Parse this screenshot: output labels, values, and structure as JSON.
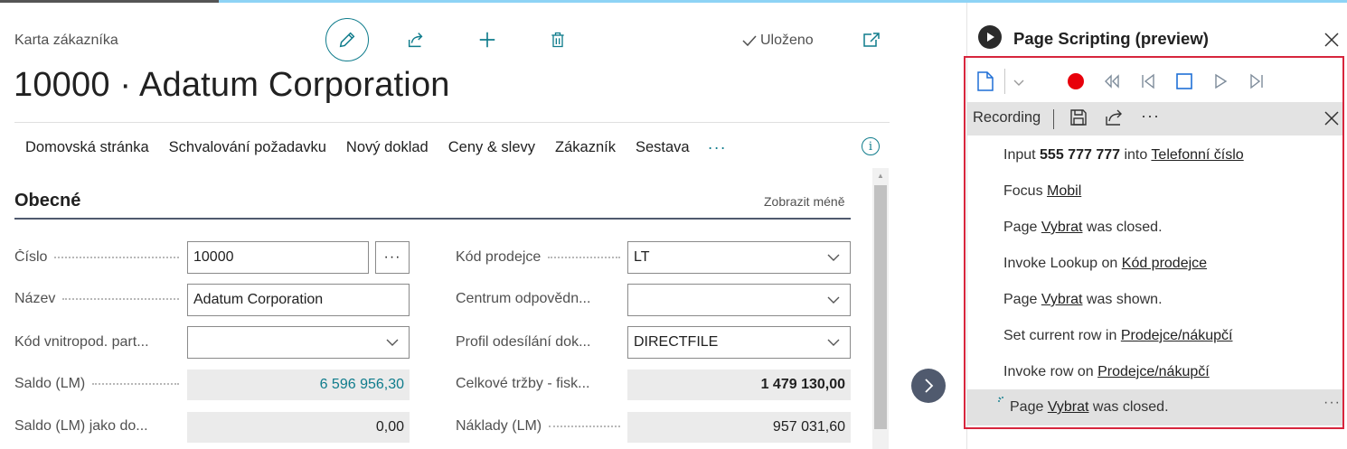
{
  "header": {
    "caption": "Karta zákazníka",
    "title": "10000 · Adatum Corporation",
    "saved": "Uloženo"
  },
  "actions": [
    "Domovská stránka",
    "Schvalování požadavku",
    "Nový doklad",
    "Ceny & slevy",
    "Zákazník",
    "Sestava"
  ],
  "actions_more": "···",
  "section": {
    "title": "Obecné",
    "toggle": "Zobrazit méně"
  },
  "fields_left": [
    {
      "label": "Číslo",
      "value": "10000",
      "kind": "text-assist"
    },
    {
      "label": "Název",
      "value": "Adatum Corporation",
      "kind": "text"
    },
    {
      "label": "Kód vnitropod. part...",
      "value": "",
      "kind": "dropdown"
    },
    {
      "label": "Saldo (LM)",
      "value": "6 596 956,30",
      "kind": "readonly-link"
    },
    {
      "label": "Saldo (LM) jako do...",
      "value": "0,00",
      "kind": "readonly"
    }
  ],
  "fields_right": [
    {
      "label": "Kód prodejce",
      "value": "LT",
      "kind": "dropdown"
    },
    {
      "label": "Centrum odpovědn...",
      "value": "",
      "kind": "dropdown"
    },
    {
      "label": "Profil odesílání dok...",
      "value": "DIRECTFILE",
      "kind": "dropdown"
    },
    {
      "label": "Celkové tržby - fisk...",
      "value": "1 479 130,00",
      "kind": "readonly-bold"
    },
    {
      "label": "Náklady (LM)",
      "value": "957 031,60",
      "kind": "readonly"
    }
  ],
  "assist_label": "···",
  "pane": {
    "title": "Page Scripting (preview)",
    "recording_label": "Recording",
    "more": "···",
    "steps": [
      {
        "pre": "Input ",
        "bold": "555 777 777",
        "mid": " into ",
        "link": "Telefonní číslo",
        "post": ""
      },
      {
        "pre": "Focus ",
        "bold": "",
        "mid": "",
        "link": "Mobil",
        "post": ""
      },
      {
        "pre": "Page ",
        "bold": "",
        "mid": "",
        "link": "Vybrat",
        "post": " was closed."
      },
      {
        "pre": "Invoke Lookup on ",
        "bold": "",
        "mid": "",
        "link": "Kód prodejce",
        "post": ""
      },
      {
        "pre": "Page ",
        "bold": "",
        "mid": "",
        "link": "Vybrat",
        "post": " was shown."
      },
      {
        "pre": "Set current row in ",
        "bold": "",
        "mid": "",
        "link": "Prodejce/nákupčí",
        "post": ""
      },
      {
        "pre": "Invoke row on ",
        "bold": "",
        "mid": "",
        "link": "Prodejce/nákupčí",
        "post": ""
      }
    ],
    "last_step": {
      "pre": "Page ",
      "link": "Vybrat",
      "post": " was closed."
    },
    "last_more": "···"
  },
  "colors": {
    "accent": "#0f7c8c",
    "record": "#e8000b",
    "highlight_border": "#d7263d"
  }
}
